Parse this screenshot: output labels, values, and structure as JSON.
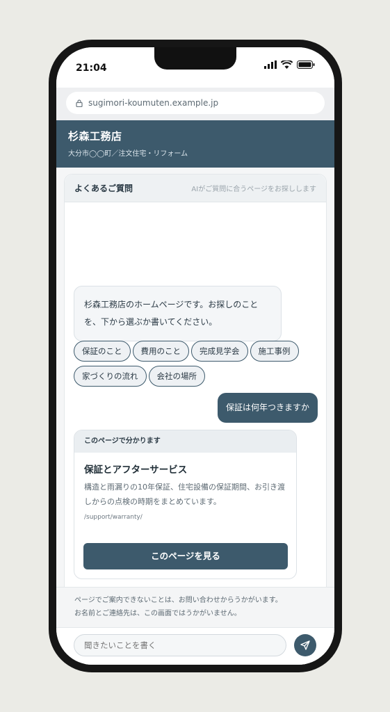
{
  "status": {
    "time": "21:04"
  },
  "browser": {
    "url": "sugimori-koumuten.example.jp"
  },
  "site": {
    "title": "杉森工務店",
    "subtitle": "大分市◯◯町／注文住宅・リフォーム"
  },
  "faq": {
    "title": "よくあるご質問",
    "note": "AIがご質問に合うページをお探しします"
  },
  "chat": {
    "bot_message": "杉森工務店のホームページです。お探しのことを、下から選ぶか書いてください。",
    "chips": [
      "保証のこと",
      "費用のこと",
      "完成見学会",
      "施工事例",
      "家づくりの流れ",
      "会社の場所"
    ],
    "user_message": "保証は何年つきますか"
  },
  "answer": {
    "header": "このページで分かります",
    "title": "保証とアフターサービス",
    "description": "構造と雨漏りの10年保証、住宅設備の保証期間、お引き渡しからの点検の時期をまとめています。",
    "path": "/support/warranty/",
    "button_label": "このページを見る"
  },
  "notice": {
    "line1": "ページでご案内できないことは、お問い合わせからうかがいます。",
    "line2": "お名前とご連絡先は、この画面ではうかがいません。"
  },
  "composer": {
    "placeholder": "聞きたいことを書く"
  },
  "colors": {
    "accent": "#3d5a6c",
    "background": "#ebebe6"
  }
}
